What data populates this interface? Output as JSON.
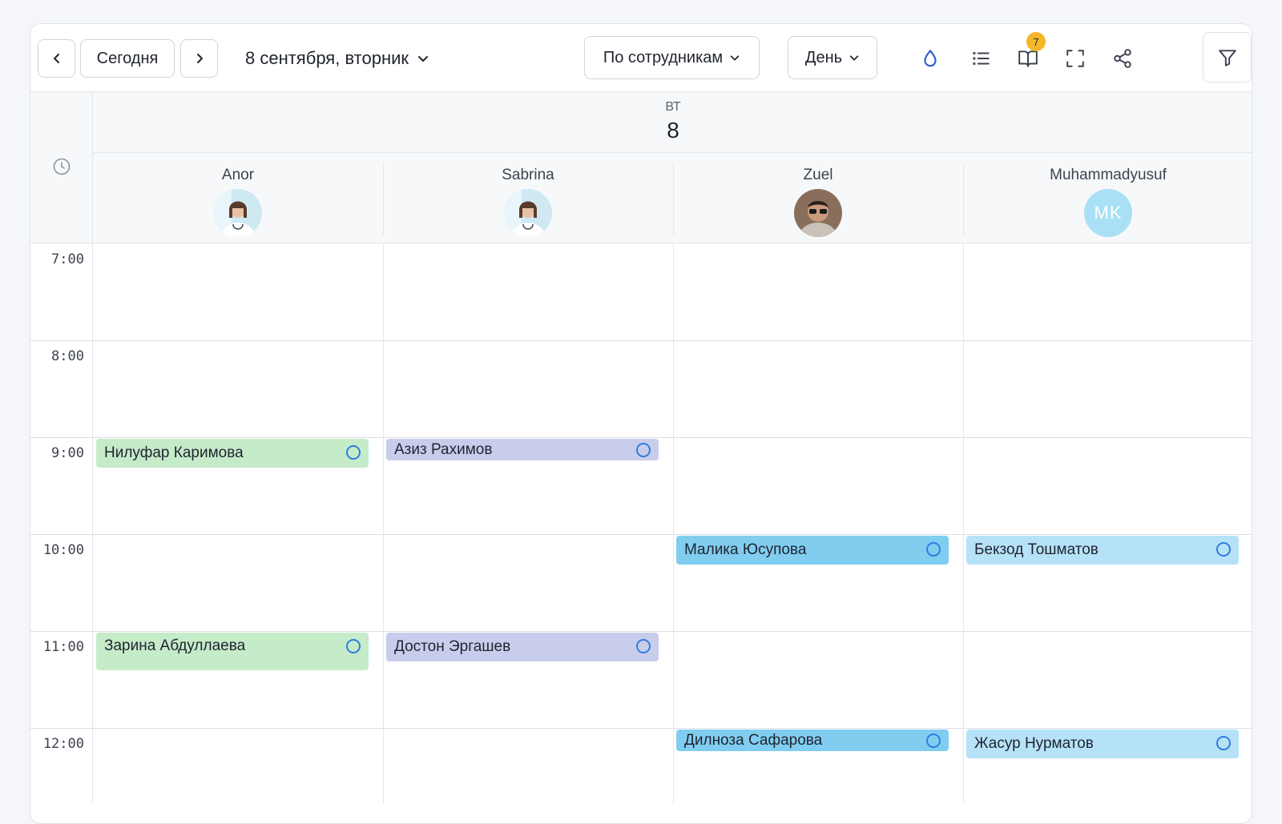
{
  "toolbar": {
    "today_label": "Сегодня",
    "date_label": "8 сентября, вторник",
    "group_by_label": "По сотрудникам",
    "view_label": "День",
    "badge_count": "7",
    "icons": [
      "chevron-left-icon",
      "chevron-right-icon",
      "chevron-down-icon",
      "drop-icon",
      "list-icon",
      "book-icon",
      "fullscreen-icon",
      "share-icon",
      "filter-icon"
    ],
    "accent_color": "#2f5fd0"
  },
  "day": {
    "dow": "ВТ",
    "num": "8"
  },
  "staff": [
    {
      "name": "Anor",
      "avatar": "photo"
    },
    {
      "name": "Sabrina",
      "avatar": "photo"
    },
    {
      "name": "Zuel",
      "avatar": "photo"
    },
    {
      "name": "Muhammadyusuf",
      "avatar": "initials",
      "initials": "MK"
    }
  ],
  "hours": [
    "7:00",
    "8:00",
    "9:00",
    "10:00",
    "11:00",
    "12:00"
  ],
  "events": [
    {
      "staff": "Anor",
      "name": "Нилуфар Каримова",
      "start": "9:00",
      "color": "#c5ebc9"
    },
    {
      "staff": "Sabrina",
      "name": "Азиз Рахимов",
      "start": "9:00",
      "color": "#c9cdec"
    },
    {
      "staff": "Zuel",
      "name": "Малика Юсупова",
      "start": "10:00",
      "color": "#80cdf0"
    },
    {
      "staff": "Muhammadyusuf",
      "name": "Бекзод Тошматов",
      "start": "10:00",
      "color": "#b6e2f7"
    },
    {
      "staff": "Anor",
      "name": "Зарина Абдуллаева",
      "start": "11:00",
      "color": "#c5ebc9"
    },
    {
      "staff": "Sabrina",
      "name": "Достон Эргашев",
      "start": "11:00",
      "color": "#c9cdec"
    },
    {
      "staff": "Zuel",
      "name": "Дилноза Сафарова",
      "start": "12:00",
      "color": "#80cdf0"
    },
    {
      "staff": "Muhammadyusuf",
      "name": "Жасур Нурматов",
      "start": "12:00",
      "color": "#b6e2f7"
    }
  ]
}
